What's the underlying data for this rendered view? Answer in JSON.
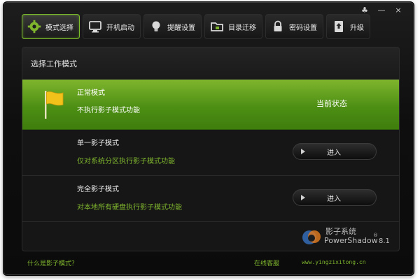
{
  "window_controls": {
    "menu": "♣",
    "minimize": "—",
    "close": "×"
  },
  "toolbar": [
    {
      "label": "模式选择",
      "icon": "gear-icon",
      "active": true
    },
    {
      "label": "开机启动",
      "icon": "monitor-icon",
      "active": false
    },
    {
      "label": "提醒设置",
      "icon": "lightbulb-icon",
      "active": false
    },
    {
      "label": "目录迁移",
      "icon": "folder-icon",
      "active": false
    },
    {
      "label": "密码设置",
      "icon": "lock-icon",
      "active": false
    },
    {
      "label": "升级",
      "icon": "upgrade-icon",
      "active": false
    }
  ],
  "panel": {
    "title": "选择工作模式",
    "modes": [
      {
        "name": "正常模式",
        "desc": "不执行影子模式功能",
        "state": "当前状态",
        "current": true
      },
      {
        "name": "单一影子模式",
        "desc": "仅对系统分区执行影子模式功能",
        "button": "进入",
        "current": false
      },
      {
        "name": "完全影子模式",
        "desc": "对本地所有硬盘执行影子模式功能",
        "button": "进入",
        "current": false
      }
    ]
  },
  "logo": {
    "title": "影子系统",
    "subtitle": "PowerShadow",
    "registered": "®",
    "version": "8.1"
  },
  "footer": {
    "help_link": "什么是影子模式？",
    "support_link": "在线客服",
    "website": "www.yingzixitong.cn"
  },
  "colors": {
    "accent": "#7fb52d",
    "accent_dark": "#3f7d0d",
    "background": "#0e0e0e"
  }
}
